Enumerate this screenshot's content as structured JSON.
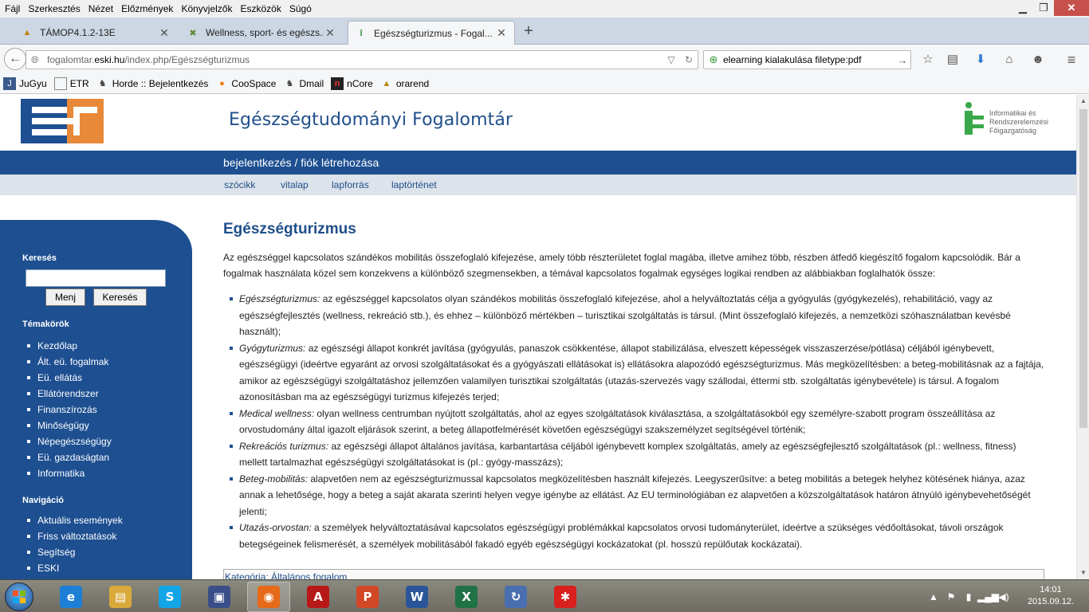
{
  "menubar": {
    "items": [
      "Fájl",
      "Szerkesztés",
      "Nézet",
      "Előzmények",
      "Könyvjelzők",
      "Eszközök",
      "Súgó"
    ]
  },
  "tabs": [
    {
      "label": "TÁMOP4.1.2-13E",
      "icon": "pma-icon"
    },
    {
      "label": "Wellness, sport- és egészs...",
      "icon": "tools-icon"
    },
    {
      "label": "Egészségturizmus - Fogal...",
      "icon": "wiki-icon"
    }
  ],
  "nav": {
    "url_prefix": "fogalomtar.",
    "url_domain": "eski.hu",
    "url_path": "/index.php/Egészségturizmus",
    "search_value": "elearning kialakulása filetype:pdf"
  },
  "bookmarks": [
    {
      "label": "JuGyu",
      "icon": "jugyu-icon"
    },
    {
      "label": "ETR",
      "icon": "page-icon"
    },
    {
      "label": "Horde :: Bejelentkezés",
      "icon": "horde-icon"
    },
    {
      "label": "CooSpace",
      "icon": "coospace-icon"
    },
    {
      "label": "Dmail",
      "icon": "horde-icon"
    },
    {
      "label": "nCore",
      "icon": "ncore-icon"
    },
    {
      "label": "orarend",
      "icon": "pma-icon"
    }
  ],
  "site": {
    "title": "Egészségtudományi Fogalomtár",
    "partner_logo_lines": [
      "Informatikai és",
      "Rendszerelemzési",
      "Főigazgatóság"
    ],
    "login_link": "bejelentkezés / fiók létrehozása",
    "subnav": [
      "szócikk",
      "vitalap",
      "lapforrás",
      "laptörténet"
    ]
  },
  "sidebar": {
    "search_heading": "Keresés",
    "go_button": "Menj",
    "search_button": "Keresés",
    "topics_heading": "Témakörök",
    "topics": [
      "Kezdőlap",
      "Ált. eü. fogalmak",
      "Eü. ellátás",
      "Ellátórendszer",
      "Finanszírozás",
      "Minőségügy",
      "Népegészségügy",
      "Eü. gazdaságtan",
      "Informatika"
    ],
    "nav_heading": "Navigáció",
    "nav_items": [
      "Aktuális események",
      "Friss változtatások",
      "Segítség",
      "ESKI"
    ]
  },
  "article": {
    "title": "Egészségturizmus",
    "intro": "Az egészséggel kapcsolatos szándékos mobilitás összefoglaló kifejezése, amely több részterületet foglal magába, illetve amihez több, részben átfedő kiegészítő fogalom kapcsolódik. Bár a fogalmak használata közel sem konzekvens a különböző szegmensekben, a témával kapcsolatos fogalmak egységes logikai rendben az alábbiakban foglalhatók össze:",
    "definitions": [
      {
        "term": "Egészségturizmus:",
        "text": " az egészséggel kapcsolatos olyan szándékos mobilitás összefoglaló kifejezése, ahol a helyváltoztatás célja a gyógyulás (gyógykezelés), rehabilitáció, vagy az egészségfejlesztés (wellness, rekreáció stb.), és ehhez – különböző mértékben – turisztikai szolgáltatás is társul. (Mint összefoglaló kifejezés, a nemzetközi szóhasználatban kevésbé használt);"
      },
      {
        "term": "Gyógyturizmus:",
        "text": " az egészségi állapot konkrét javítása (gyógyulás, panaszok csökkentése, állapot stabilizálása, elveszett képességek visszaszerzése/pótlása) céljából igénybevett, egészségügyi (ideértve egyaránt az orvosi szolgáltatásokat és a gyógyászati ellátásokat is) ellátásokra alapozódó egészségturizmus. Más megközelítésben: a beteg-mobilitásnak az a fajtája, amikor az egészségügyi szolgáltatáshoz jellemzően valamilyen turisztikai szolgáltatás (utazás-szervezés vagy szállodai, éttermi stb. szolgáltatás igénybevétele) is társul. A fogalom azonosításban ma az egészségügyi turizmus kifejezés terjed;"
      },
      {
        "term": "Medical wellness:",
        "text": " olyan wellness centrumban nyújtott szolgáltatás, ahol az egyes szolgáltatások kiválasztása, a szolgáltatásokból egy személyre-szabott program összeállítása az orvostudomány által igazolt eljárások szerint, a beteg állapotfelmérését követően egészségügyi szakszemélyzet segítségével történik;"
      },
      {
        "term": "Rekreációs turizmus:",
        "text": " az egészségi állapot általános javítása, karbantartása céljából igénybevett komplex szolgáltatás, amely az egészségfejlesztő szolgáltatások (pl.: wellness, fitness) mellett tartalmazhat egészségügyi szolgáltatásokat is (pl.: gyógy-masszázs);"
      },
      {
        "term": "Beteg-mobilitás:",
        "text": " alapvetően nem az egészségturizmussal kapcsolatos megközelítésben használt kifejezés. Leegyszerűsítve: a beteg mobilitás a betegek helyhez kötésének hiánya, azaz annak a lehetősége, hogy a beteg a saját akarata szerinti helyen vegye igénybe az ellátást. Az EU terminológiában ez alapvetően a közszolgáltatások határon átnyúló igénybevehetőségét jelenti;"
      },
      {
        "term": "Utazás-orvostan:",
        "text": " a személyek helyváltoztatásával kapcsolatos egészségügyi problémákkal kapcsolatos orvosi tudományterület, ideértve a szükséges védőoltásokat, távoli országok betegségeinek felismerését, a személyek mobilitásából fakadó egyéb egészségügyi kockázatokat (pl. hosszú repülőutak kockázatai)."
      }
    ],
    "category": "Kategória: Általános fogalom"
  },
  "taskbar": {
    "apps": [
      {
        "name": "ie-icon",
        "glyph": "e",
        "color": "#1e7fd6"
      },
      {
        "name": "explorer-icon",
        "glyph": "▤",
        "color": "#d9a93a"
      },
      {
        "name": "skype-icon",
        "glyph": "S",
        "color": "#12a5e8"
      },
      {
        "name": "save-icon",
        "glyph": "▣",
        "color": "#3a4f8a"
      },
      {
        "name": "firefox-icon",
        "glyph": "◉",
        "color": "#e66a1a"
      },
      {
        "name": "pdf-icon",
        "glyph": "A",
        "color": "#b71818"
      },
      {
        "name": "powerpoint-icon",
        "glyph": "P",
        "color": "#d24726"
      },
      {
        "name": "word-icon",
        "glyph": "W",
        "color": "#2a5699"
      },
      {
        "name": "excel-icon",
        "glyph": "X",
        "color": "#207245"
      },
      {
        "name": "sync-icon",
        "glyph": "↻",
        "color": "#4a6fb0"
      },
      {
        "name": "paint-icon",
        "glyph": "✱",
        "color": "#d8201c"
      }
    ],
    "time": "14:01",
    "date": "2015.09.12."
  }
}
